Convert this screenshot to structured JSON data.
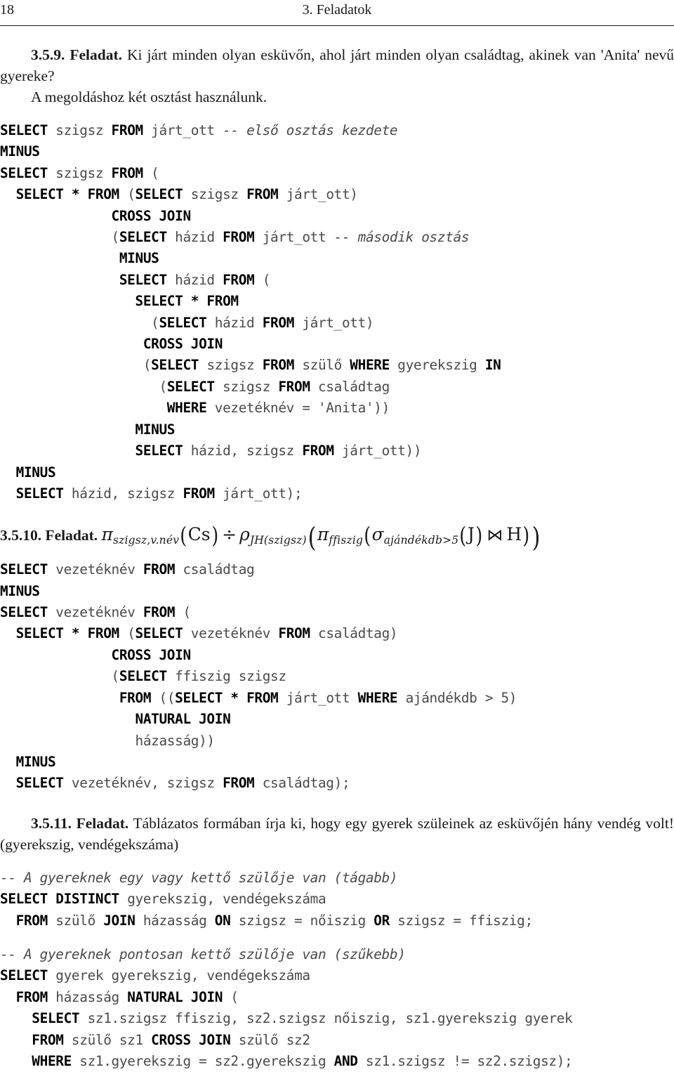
{
  "header": {
    "folio": "18",
    "chapter_title": "3. Feladatok"
  },
  "exercises": [
    {
      "number": "3.5.9. Feladat.",
      "prompt": "Ki járt minden olyan esküvőn, ahol járt minden olyan családtag, akinek van 'Anita' nevű gyereke?",
      "note": "A megoldáshoz két osztást használunk.",
      "code_lines": [
        [
          {
            "t": "SELECT",
            "s": "kw"
          },
          {
            "t": " szigsz ",
            "s": "id"
          },
          {
            "t": "FROM",
            "s": "kw"
          },
          {
            "t": " járt_ott ",
            "s": "id"
          },
          {
            "t": "-- első osztás kezdete",
            "s": "cm"
          }
        ],
        [
          {
            "t": "MINUS",
            "s": "kw"
          }
        ],
        [
          {
            "t": "SELECT",
            "s": "kw"
          },
          {
            "t": " szigsz ",
            "s": "id"
          },
          {
            "t": "FROM",
            "s": "kw"
          },
          {
            "t": " (",
            "s": "id"
          }
        ],
        [
          {
            "t": "  SELECT * FROM",
            "s": "kw"
          },
          {
            "t": " (",
            "s": "id"
          },
          {
            "t": "SELECT",
            "s": "kw"
          },
          {
            "t": " szigsz ",
            "s": "id"
          },
          {
            "t": "FROM",
            "s": "kw"
          },
          {
            "t": " járt_ott)",
            "s": "id"
          }
        ],
        [
          {
            "t": "              CROSS JOIN",
            "s": "kw"
          }
        ],
        [
          {
            "t": "              (",
            "s": "id"
          },
          {
            "t": "SELECT",
            "s": "kw"
          },
          {
            "t": " házid ",
            "s": "id"
          },
          {
            "t": "FROM",
            "s": "kw"
          },
          {
            "t": " járt_ott ",
            "s": "id"
          },
          {
            "t": "-- második osztás",
            "s": "cm"
          }
        ],
        [
          {
            "t": "               MINUS",
            "s": "kw"
          }
        ],
        [
          {
            "t": "               SELECT",
            "s": "kw"
          },
          {
            "t": " házid ",
            "s": "id"
          },
          {
            "t": "FROM",
            "s": "kw"
          },
          {
            "t": " (",
            "s": "id"
          }
        ],
        [
          {
            "t": "                 SELECT * FROM",
            "s": "kw"
          }
        ],
        [
          {
            "t": "                   (",
            "s": "id"
          },
          {
            "t": "SELECT",
            "s": "kw"
          },
          {
            "t": " házid ",
            "s": "id"
          },
          {
            "t": "FROM",
            "s": "kw"
          },
          {
            "t": " járt_ott)",
            "s": "id"
          }
        ],
        [
          {
            "t": "                  CROSS JOIN",
            "s": "kw"
          }
        ],
        [
          {
            "t": "                  (",
            "s": "id"
          },
          {
            "t": "SELECT",
            "s": "kw"
          },
          {
            "t": " szigsz ",
            "s": "id"
          },
          {
            "t": "FROM",
            "s": "kw"
          },
          {
            "t": " szülő ",
            "s": "id"
          },
          {
            "t": "WHERE",
            "s": "kw"
          },
          {
            "t": " gyerekszig ",
            "s": "id"
          },
          {
            "t": "IN",
            "s": "kw"
          }
        ],
        [
          {
            "t": "                    (",
            "s": "id"
          },
          {
            "t": "SELECT",
            "s": "kw"
          },
          {
            "t": " szigsz ",
            "s": "id"
          },
          {
            "t": "FROM",
            "s": "kw"
          },
          {
            "t": " családtag",
            "s": "id"
          }
        ],
        [
          {
            "t": "                     WHERE",
            "s": "kw"
          },
          {
            "t": " vezetéknév = 'Anita'))",
            "s": "id"
          }
        ],
        [
          {
            "t": "                 MINUS",
            "s": "kw"
          }
        ],
        [
          {
            "t": "                 SELECT",
            "s": "kw"
          },
          {
            "t": " házid, szigsz ",
            "s": "id"
          },
          {
            "t": "FROM",
            "s": "kw"
          },
          {
            "t": " járt_ott))",
            "s": "id"
          }
        ],
        [
          {
            "t": "  MINUS",
            "s": "kw"
          }
        ],
        [
          {
            "t": "  SELECT",
            "s": "kw"
          },
          {
            "t": " házid, szigsz ",
            "s": "id"
          },
          {
            "t": "FROM",
            "s": "kw"
          },
          {
            "t": " járt_ott);",
            "s": "id"
          }
        ]
      ]
    },
    {
      "number": "3.5.10. Feladat.",
      "formula_plain": "π_{szigsz,v.név}(Cs) ÷ ρ_{JH(szigsz)}(π_{ffiszig}(σ_{ajándékdb>5}(J) ⋈ H))",
      "formula_parts": {
        "pi1": "π",
        "pi1_sub": "szigsz,v.név",
        "arg1": "Cs",
        "divide": "÷",
        "rho": "ρ",
        "rho_sub": "JH(szigsz)",
        "pi2": "π",
        "pi2_sub": "ffiszig",
        "sigma": "σ",
        "sigma_sub": "ajándékdb>5",
        "arg_j": "J",
        "join": "⋈",
        "arg_h": "H"
      },
      "code_lines": [
        [
          {
            "t": "SELECT",
            "s": "kw"
          },
          {
            "t": " vezetéknév ",
            "s": "id"
          },
          {
            "t": "FROM",
            "s": "kw"
          },
          {
            "t": " családtag",
            "s": "id"
          }
        ],
        [
          {
            "t": "MINUS",
            "s": "kw"
          }
        ],
        [
          {
            "t": "SELECT",
            "s": "kw"
          },
          {
            "t": " vezetéknév ",
            "s": "id"
          },
          {
            "t": "FROM",
            "s": "kw"
          },
          {
            "t": " (",
            "s": "id"
          }
        ],
        [
          {
            "t": "  SELECT * FROM",
            "s": "kw"
          },
          {
            "t": " (",
            "s": "id"
          },
          {
            "t": "SELECT",
            "s": "kw"
          },
          {
            "t": " vezetéknév ",
            "s": "id"
          },
          {
            "t": "FROM",
            "s": "kw"
          },
          {
            "t": " családtag)",
            "s": "id"
          }
        ],
        [
          {
            "t": "              CROSS JOIN",
            "s": "kw"
          }
        ],
        [
          {
            "t": "              (",
            "s": "id"
          },
          {
            "t": "SELECT",
            "s": "kw"
          },
          {
            "t": " ffiszig szigsz",
            "s": "id"
          }
        ],
        [
          {
            "t": "               FROM",
            "s": "kw"
          },
          {
            "t": " ((",
            "s": "id"
          },
          {
            "t": "SELECT * FROM",
            "s": "kw"
          },
          {
            "t": " járt_ott ",
            "s": "id"
          },
          {
            "t": "WHERE",
            "s": "kw"
          },
          {
            "t": " ajándékdb > 5)",
            "s": "id"
          }
        ],
        [
          {
            "t": "                 NATURAL JOIN",
            "s": "kw"
          }
        ],
        [
          {
            "t": "                 házasság))",
            "s": "id"
          }
        ],
        [
          {
            "t": "  MINUS",
            "s": "kw"
          }
        ],
        [
          {
            "t": "  SELECT",
            "s": "kw"
          },
          {
            "t": " vezetéknév, szigsz ",
            "s": "id"
          },
          {
            "t": "FROM",
            "s": "kw"
          },
          {
            "t": " családtag);",
            "s": "id"
          }
        ]
      ]
    },
    {
      "number": "3.5.11. Feladat.",
      "prompt": "Táblázatos formában írja ki, hogy egy gyerek szüleinek az esküvőjén hány vendég volt! (gyerekszig, vendégekszáma)",
      "code_block_1": [
        [
          {
            "t": "-- A gyereknek egy vagy kettő szülője van (tágabb)",
            "s": "cm"
          }
        ],
        [
          {
            "t": "SELECT DISTINCT",
            "s": "kw"
          },
          {
            "t": " gyerekszig, vendégekszáma",
            "s": "id"
          }
        ],
        [
          {
            "t": "  FROM",
            "s": "kw"
          },
          {
            "t": " szülő ",
            "s": "id"
          },
          {
            "t": "JOIN",
            "s": "kw"
          },
          {
            "t": " házasság ",
            "s": "id"
          },
          {
            "t": "ON",
            "s": "kw"
          },
          {
            "t": " szigsz = nőiszig ",
            "s": "id"
          },
          {
            "t": "OR",
            "s": "kw"
          },
          {
            "t": " szigsz = ffiszig;",
            "s": "id"
          }
        ]
      ],
      "code_block_2": [
        [
          {
            "t": "-- A gyereknek pontosan kettő szülője van (szűkebb)",
            "s": "cm"
          }
        ],
        [
          {
            "t": "SELECT",
            "s": "kw"
          },
          {
            "t": " gyerek gyerekszig, vendégekszáma",
            "s": "id"
          }
        ],
        [
          {
            "t": "  FROM",
            "s": "kw"
          },
          {
            "t": " házasság ",
            "s": "id"
          },
          {
            "t": "NATURAL JOIN",
            "s": "kw"
          },
          {
            "t": " (",
            "s": "id"
          }
        ],
        [
          {
            "t": "    SELECT",
            "s": "kw"
          },
          {
            "t": " sz1.szigsz ffiszig, sz2.szigsz nőiszig, sz1.gyerekszig gyerek",
            "s": "id"
          }
        ],
        [
          {
            "t": "    FROM",
            "s": "kw"
          },
          {
            "t": " szülő sz1 ",
            "s": "id"
          },
          {
            "t": "CROSS JOIN",
            "s": "kw"
          },
          {
            "t": " szülő sz2",
            "s": "id"
          }
        ],
        [
          {
            "t": "    WHERE",
            "s": "kw"
          },
          {
            "t": " sz1.gyerekszig = sz2.gyerekszig ",
            "s": "id"
          },
          {
            "t": "AND",
            "s": "kw"
          },
          {
            "t": " sz1.szigsz != sz2.szigsz);",
            "s": "id"
          }
        ]
      ]
    }
  ]
}
